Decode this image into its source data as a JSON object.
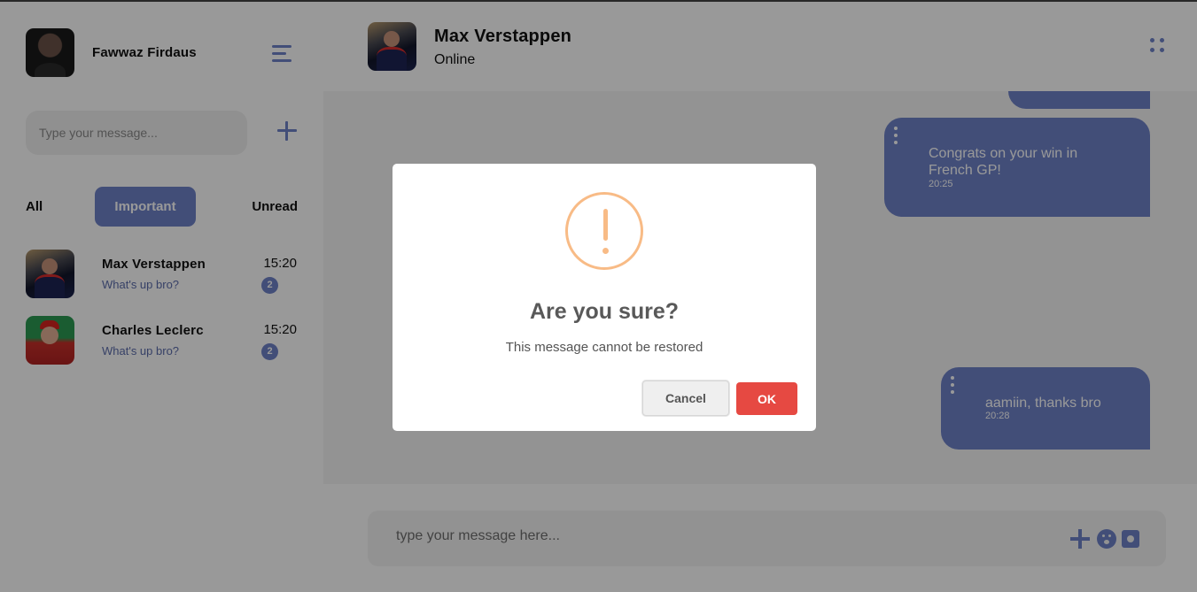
{
  "user": {
    "name": "Fawwaz Firdaus"
  },
  "sidebar": {
    "search_placeholder": "Type your message...",
    "filters": {
      "all": "All",
      "important": "Important",
      "unread": "Unread"
    },
    "contacts": [
      {
        "name": "Max Verstappen",
        "message": "What's up bro?",
        "time": "15:20",
        "unread": "2"
      },
      {
        "name": "Charles Leclerc",
        "message": "What's up bro?",
        "time": "15:20",
        "unread": "2"
      }
    ]
  },
  "chat": {
    "contact_name": "Max Verstappen",
    "status": "Online",
    "messages": [
      {
        "text": "Congrats on your win in French GP!",
        "time": "20:25"
      },
      {
        "text": "aamiin, thanks bro",
        "time": "20:28"
      }
    ],
    "composer_placeholder": "type your message here..."
  },
  "dialog": {
    "title": "Are you sure?",
    "text": "This message cannot be restored",
    "cancel_label": "Cancel",
    "ok_label": "OK"
  },
  "icons": {
    "menu": "hamburger-menu-icon",
    "add": "plus-icon",
    "options": "kebab-dots-icon",
    "warning": "warning-exclamation-icon",
    "emoji": "emoji-icon",
    "camera": "camera-icon"
  },
  "colors": {
    "accent": "#6f82c9",
    "ok_button": "#e64942",
    "warning": "#f8bb86",
    "overlay": "rgba(0,0,0,0.4)"
  }
}
